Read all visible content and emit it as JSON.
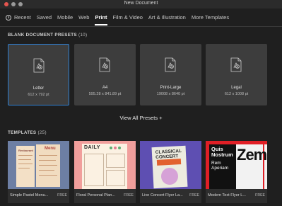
{
  "window": {
    "title": "New Document"
  },
  "tabs": [
    {
      "label": "Recent",
      "icon": "clock-icon"
    },
    {
      "label": "Saved"
    },
    {
      "label": "Mobile"
    },
    {
      "label": "Web"
    },
    {
      "label": "Print",
      "active": true
    },
    {
      "label": "Film & Video"
    },
    {
      "label": "Art & Illustration"
    },
    {
      "label": "More Templates"
    }
  ],
  "blank_presets": {
    "title": "BLANK DOCUMENT PRESETS",
    "count": "(10)",
    "items": [
      {
        "name": "Letter",
        "size": "612 x 792 pt",
        "selected": true
      },
      {
        "name": "A4",
        "size": "595.28 x 841.89 pt"
      },
      {
        "name": "Print-Large",
        "size": "19008 x 8640 pt"
      },
      {
        "name": "Legal",
        "size": "612 x 1008 pt"
      }
    ],
    "view_all": "View All Presets +"
  },
  "templates": {
    "title": "TEMPLATES",
    "count": "(25)",
    "items": [
      {
        "label": "Simple Pastel Menu...",
        "badge": "FREE",
        "thumb_text": [
          "Menu",
          "Restaurant"
        ]
      },
      {
        "label": "Floral Personal Plan...",
        "badge": "FREE",
        "thumb_text": [
          "DAILY"
        ]
      },
      {
        "label": "Live Concert Flyer La...",
        "badge": "FREE",
        "thumb_text": [
          "CLASSICAL",
          "CONCERT"
        ]
      },
      {
        "label": "Modern Text Flyer L...",
        "badge": "FREE",
        "thumb_text": [
          "Quis",
          "Nostrum",
          "Rem",
          "Aperiam",
          "Zemo"
        ]
      }
    ]
  },
  "colors": {
    "accent": "#2d7fd3",
    "background": "#1f1f1f",
    "card": "#3d3d3d"
  }
}
